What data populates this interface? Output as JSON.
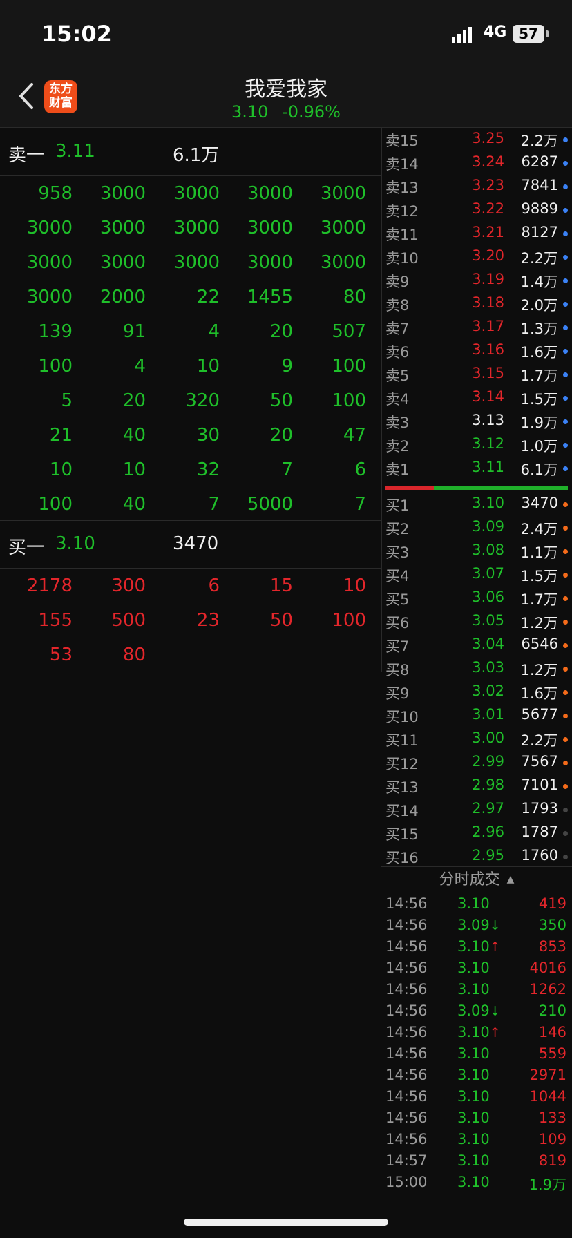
{
  "status_bar": {
    "time": "15:02",
    "network": "4G",
    "battery": "57"
  },
  "header": {
    "logo": "东方财富",
    "title": "我爱我家",
    "price": "3.10",
    "change": "-0.96%"
  },
  "sell_one": {
    "label": "卖一",
    "price": "3.11",
    "volume": "6.1万"
  },
  "sell_queue": [
    [
      "958",
      "3000",
      "3000",
      "3000",
      "3000"
    ],
    [
      "3000",
      "3000",
      "3000",
      "3000",
      "3000"
    ],
    [
      "3000",
      "3000",
      "3000",
      "3000",
      "3000"
    ],
    [
      "3000",
      "2000",
      "22",
      "1455",
      "80"
    ],
    [
      "139",
      "91",
      "4",
      "20",
      "507"
    ],
    [
      "100",
      "4",
      "10",
      "9",
      "100"
    ],
    [
      "5",
      "20",
      "320",
      "50",
      "100"
    ],
    [
      "21",
      "40",
      "30",
      "20",
      "47"
    ],
    [
      "10",
      "10",
      "32",
      "7",
      "6"
    ],
    [
      "100",
      "40",
      "7",
      "5000",
      "7"
    ]
  ],
  "buy_one": {
    "label": "买一",
    "price": "3.10",
    "volume": "3470"
  },
  "buy_queue": [
    [
      "2178",
      "300",
      "6",
      "15",
      "10"
    ],
    [
      "155",
      "500",
      "23",
      "50",
      "100"
    ],
    [
      "53",
      "80"
    ]
  ],
  "order_book_sell": [
    {
      "label": "卖15",
      "price": "3.25",
      "vol": "2.2万",
      "color": "red"
    },
    {
      "label": "卖14",
      "price": "3.24",
      "vol": "6287",
      "color": "red"
    },
    {
      "label": "卖13",
      "price": "3.23",
      "vol": "7841",
      "color": "red"
    },
    {
      "label": "卖12",
      "price": "3.22",
      "vol": "9889",
      "color": "red"
    },
    {
      "label": "卖11",
      "price": "3.21",
      "vol": "8127",
      "color": "red"
    },
    {
      "label": "卖10",
      "price": "3.20",
      "vol": "2.2万",
      "color": "red"
    },
    {
      "label": "卖9",
      "price": "3.19",
      "vol": "1.4万",
      "color": "red"
    },
    {
      "label": "卖8",
      "price": "3.18",
      "vol": "2.0万",
      "color": "red"
    },
    {
      "label": "卖7",
      "price": "3.17",
      "vol": "1.3万",
      "color": "red"
    },
    {
      "label": "卖6",
      "price": "3.16",
      "vol": "1.6万",
      "color": "red"
    },
    {
      "label": "卖5",
      "price": "3.15",
      "vol": "1.7万",
      "color": "red"
    },
    {
      "label": "卖4",
      "price": "3.14",
      "vol": "1.5万",
      "color": "red"
    },
    {
      "label": "卖3",
      "price": "3.13",
      "vol": "1.9万",
      "color": "white"
    },
    {
      "label": "卖2",
      "price": "3.12",
      "vol": "1.0万",
      "color": "green"
    },
    {
      "label": "卖1",
      "price": "3.11",
      "vol": "6.1万",
      "color": "green"
    }
  ],
  "order_book_buy": [
    {
      "label": "买1",
      "price": "3.10",
      "vol": "3470",
      "dot": "orange"
    },
    {
      "label": "买2",
      "price": "3.09",
      "vol": "2.4万",
      "dot": "orange"
    },
    {
      "label": "买3",
      "price": "3.08",
      "vol": "1.1万",
      "dot": "orange"
    },
    {
      "label": "买4",
      "price": "3.07",
      "vol": "1.5万",
      "dot": "orange"
    },
    {
      "label": "买5",
      "price": "3.06",
      "vol": "1.7万",
      "dot": "orange"
    },
    {
      "label": "买6",
      "price": "3.05",
      "vol": "1.2万",
      "dot": "orange"
    },
    {
      "label": "买7",
      "price": "3.04",
      "vol": "6546",
      "dot": "orange"
    },
    {
      "label": "买8",
      "price": "3.03",
      "vol": "1.2万",
      "dot": "orange"
    },
    {
      "label": "买9",
      "price": "3.02",
      "vol": "1.6万",
      "dot": "orange"
    },
    {
      "label": "买10",
      "price": "3.01",
      "vol": "5677",
      "dot": "orange"
    },
    {
      "label": "买11",
      "price": "3.00",
      "vol": "2.2万",
      "dot": "orange"
    },
    {
      "label": "买12",
      "price": "2.99",
      "vol": "7567",
      "dot": "orange"
    },
    {
      "label": "买13",
      "price": "2.98",
      "vol": "7101",
      "dot": "orange"
    },
    {
      "label": "买14",
      "price": "2.97",
      "vol": "1793",
      "dot": "dim"
    },
    {
      "label": "买15",
      "price": "2.96",
      "vol": "1787",
      "dot": "dim"
    },
    {
      "label": "买16",
      "price": "2.95",
      "vol": "1760",
      "dot": "dim"
    }
  ],
  "ticks_title": "分时成交",
  "ticks": [
    {
      "time": "14:56",
      "price": "3.10",
      "arrow": "",
      "vol": "419"
    },
    {
      "time": "14:56",
      "price": "3.09",
      "arrow": "↓",
      "vol": "350"
    },
    {
      "time": "14:56",
      "price": "3.10",
      "arrow": "↑",
      "vol": "853"
    },
    {
      "time": "14:56",
      "price": "3.10",
      "arrow": "",
      "vol": "4016"
    },
    {
      "time": "14:56",
      "price": "3.10",
      "arrow": "",
      "vol": "1262"
    },
    {
      "time": "14:56",
      "price": "3.09",
      "arrow": "↓",
      "vol": "210"
    },
    {
      "time": "14:56",
      "price": "3.10",
      "arrow": "↑",
      "vol": "146"
    },
    {
      "time": "14:56",
      "price": "3.10",
      "arrow": "",
      "vol": "559"
    },
    {
      "time": "14:56",
      "price": "3.10",
      "arrow": "",
      "vol": "2971"
    },
    {
      "time": "14:56",
      "price": "3.10",
      "arrow": "",
      "vol": "1044"
    },
    {
      "time": "14:56",
      "price": "3.10",
      "arrow": "",
      "vol": "133"
    },
    {
      "time": "14:56",
      "price": "3.10",
      "arrow": "",
      "vol": "109"
    },
    {
      "time": "14:57",
      "price": "3.10",
      "arrow": "",
      "vol": "819"
    },
    {
      "time": "15:00",
      "price": "3.10",
      "arrow": "",
      "vol": "1.9万"
    }
  ],
  "tick_volume_colors": [
    "red",
    "green",
    "red",
    "red",
    "red",
    "green",
    "red",
    "red",
    "red",
    "red",
    "red",
    "red",
    "red",
    "green"
  ]
}
